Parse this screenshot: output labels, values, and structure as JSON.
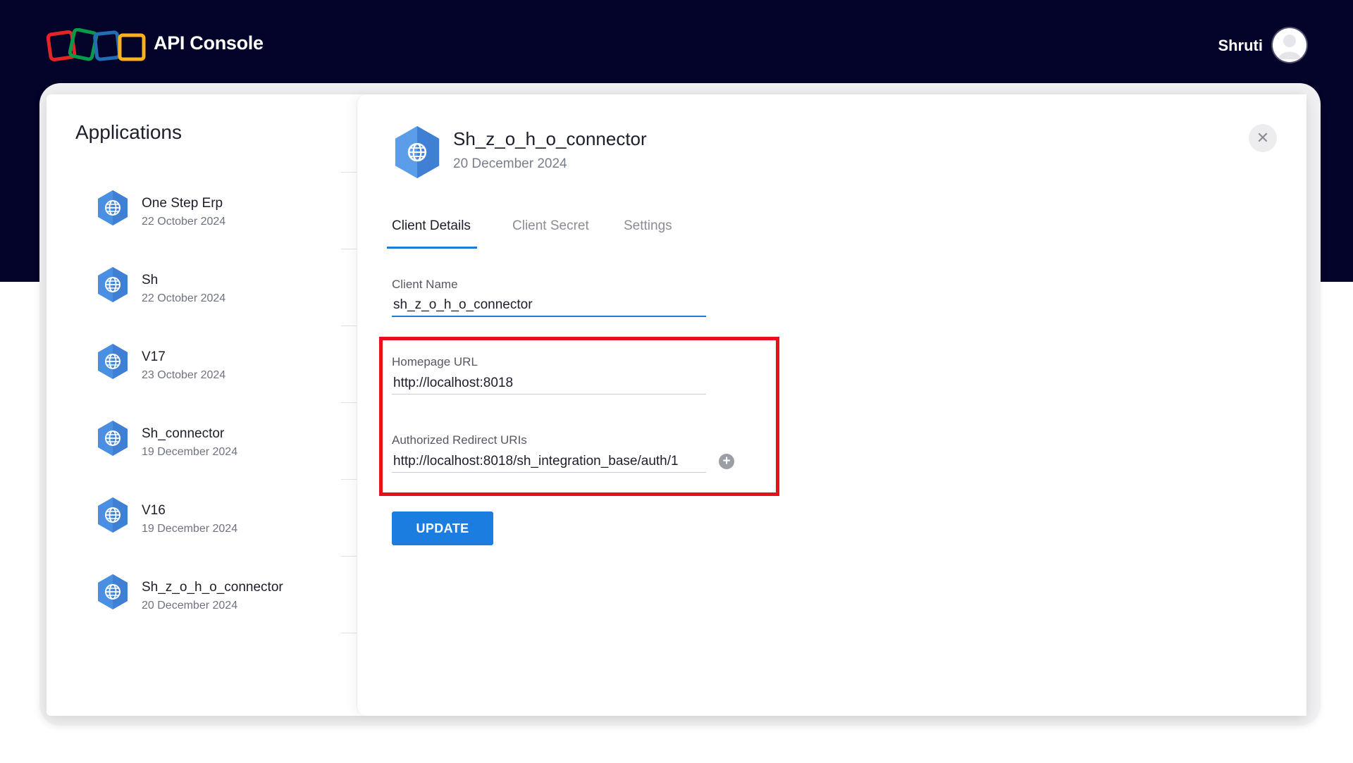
{
  "header": {
    "app_title": "API Console",
    "user_name": "Shruti",
    "brand_colors": [
      "#e42527",
      "#089949",
      "#226db4",
      "#f9b21d"
    ]
  },
  "sidebar": {
    "title": "Applications",
    "items": [
      {
        "name": "One Step Erp",
        "date": "22 October 2024",
        "icon": "globe-icon"
      },
      {
        "name": "Sh",
        "date": "22 October 2024",
        "icon": "globe-icon"
      },
      {
        "name": "V17",
        "date": "23 October 2024",
        "icon": "globe-icon"
      },
      {
        "name": "Sh_connector",
        "date": "19 December 2024",
        "icon": "globe-icon"
      },
      {
        "name": "V16",
        "date": "19 December 2024",
        "icon": "globe-icon"
      },
      {
        "name": "Sh_z_o_h_o_connector",
        "date": "20 December 2024",
        "icon": "globe-icon"
      }
    ]
  },
  "detail": {
    "title": "Sh_z_o_h_o_connector",
    "date": "20 December 2024",
    "tabs": [
      {
        "label": "Client Details",
        "active": true
      },
      {
        "label": "Client Secret",
        "active": false
      },
      {
        "label": "Settings",
        "active": false
      }
    ],
    "client_name": {
      "label": "Client Name",
      "value": "sh_z_o_h_o_connector"
    },
    "homepage_url": {
      "label": "Homepage URL",
      "value": "http://localhost:8018"
    },
    "redirect_uris": {
      "label": "Authorized Redirect URIs",
      "value": "http://localhost:8018/sh_integration_base/auth/1"
    },
    "update_label": "UPDATE",
    "accent_color": "#1f7bd8",
    "highlight_color": "#e8101c"
  }
}
